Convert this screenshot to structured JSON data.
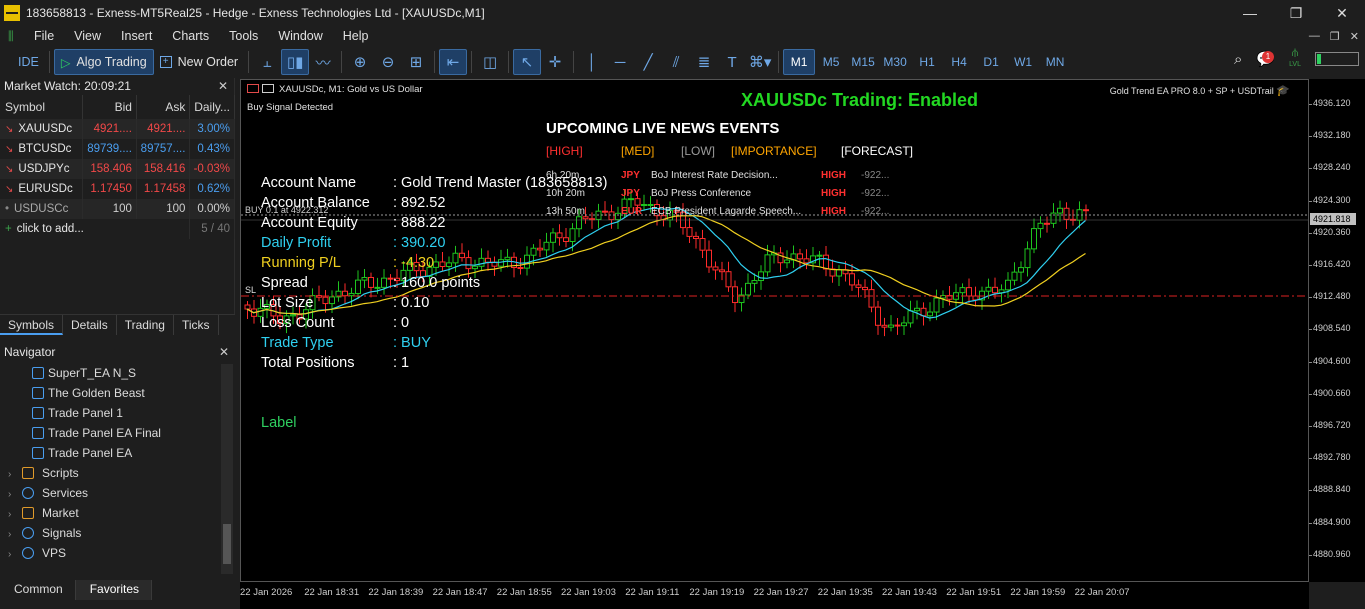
{
  "window": {
    "title": "183658813 - Exness-MT5Real25 - Hedge - Exness Technologies Ltd - [XAUUSDc,M1]",
    "buttons": [
      "—",
      "❐",
      "✕"
    ]
  },
  "menu": [
    "File",
    "View",
    "Insert",
    "Charts",
    "Tools",
    "Window",
    "Help"
  ],
  "toolbar": {
    "ide": "IDE",
    "algo_trading": "Algo Trading",
    "new_order": "New Order",
    "timeframes": [
      "M1",
      "M5",
      "M15",
      "M30",
      "H1",
      "H4",
      "D1",
      "W1",
      "MN"
    ],
    "active_timeframe": "M1",
    "notification_count": "1",
    "lvl": "LVL"
  },
  "market_watch": {
    "header": "Market Watch: 20:09:21",
    "columns": [
      "Symbol",
      "Bid",
      "Ask",
      "Daily..."
    ],
    "rows": [
      {
        "symbol": "XAUUSDc",
        "bid": "4921....",
        "ask": "4921....",
        "daily": "3.00%",
        "trend": "down"
      },
      {
        "symbol": "BTCUSDc",
        "bid": "89739....",
        "ask": "89757....",
        "daily": "0.43%",
        "trend": "down"
      },
      {
        "symbol": "USDJPYc",
        "bid": "158.406",
        "ask": "158.416",
        "daily": "-0.03%",
        "trend": "down"
      },
      {
        "symbol": "EURUSDc",
        "bid": "1.17450",
        "ask": "1.17458",
        "daily": "0.62%",
        "trend": "down"
      },
      {
        "symbol": "USDUSCc",
        "bid": "100",
        "ask": "100",
        "daily": "0.00%",
        "trend": "flat"
      }
    ],
    "click_to_add": "click to add...",
    "count": "5 / 40",
    "tabs": [
      "Symbols",
      "Details",
      "Trading",
      "Ticks"
    ]
  },
  "navigator": {
    "header": "Navigator",
    "items": [
      {
        "label": "SuperT_EA N_S",
        "type": "ea"
      },
      {
        "label": "The Golden Beast",
        "type": "ea"
      },
      {
        "label": "Trade Panel 1",
        "type": "ea"
      },
      {
        "label": "Trade Panel EA Final",
        "type": "ea"
      },
      {
        "label": "Trade Panel EA",
        "type": "ea"
      },
      {
        "label": "Scripts",
        "type": "folder"
      },
      {
        "label": "Services",
        "type": "folder"
      },
      {
        "label": "Market",
        "type": "folder"
      },
      {
        "label": "Signals",
        "type": "folder"
      },
      {
        "label": "VPS",
        "type": "folder"
      }
    ],
    "tabs": [
      "Common",
      "Favorites"
    ]
  },
  "chart": {
    "title": "XAUUSDc, M1:  Gold vs US Dollar",
    "buy_signal": "Buy Signal Detected",
    "ea_name": "Gold Trend EA PRO 8.0 + SP + USDTrail",
    "trading_status": "XAUUSDc Trading: Enabled",
    "news_title": "UPCOMING LIVE NEWS EVENTS",
    "legend": [
      {
        "text": "[HIGH]",
        "color": "#ff3030"
      },
      {
        "text": "[MED]",
        "color": "#ffa500"
      },
      {
        "text": "[LOW]",
        "color": "#9a9a9a"
      },
      {
        "text": "[IMPORTANCE]",
        "color": "#ffa500"
      },
      {
        "text": "[FORECAST]",
        "color": "#ffffff"
      }
    ],
    "news": [
      {
        "time": "6h 20m",
        "currency": "JPY",
        "event": "BoJ Interest Rate Decision...",
        "impact": "HIGH",
        "forecast": "-922..."
      },
      {
        "time": "10h 20m",
        "currency": "JPY",
        "event": "BoJ Press Conference",
        "impact": "HIGH",
        "forecast": "-922..."
      },
      {
        "time": "13h 50m",
        "currency": "EUR",
        "event": "ECB President Lagarde Speech...",
        "impact": "HIGH",
        "forecast": "-922..."
      }
    ],
    "account": [
      {
        "label": "Account Name",
        "value": ": Gold Trend Master (183658813)",
        "color": "#ffffff"
      },
      {
        "label": "Account Balance",
        "value": ": 892.52",
        "color": "#ffffff"
      },
      {
        "label": "Account Equity",
        "value": ": 888.22",
        "color": "#ffffff"
      },
      {
        "label": "Daily Profit",
        "value": ": 390.20",
        "color": "#2fd0f0"
      },
      {
        "label": "Running P/L",
        "value": ": -4.30",
        "color": "#f0d020"
      },
      {
        "label": "Spread",
        "value": ": 160.0 points",
        "color": "#ffffff"
      },
      {
        "label": "Lot Size",
        "value": ": 0.10",
        "color": "#ffffff"
      },
      {
        "label": "Loss Count",
        "value": ": 0",
        "color": "#ffffff"
      },
      {
        "label": "Trade Type",
        "value": ": BUY",
        "color": "#2fd0f0"
      },
      {
        "label": "Total Positions",
        "value": ": 1",
        "color": "#ffffff"
      }
    ],
    "label_text": "Label",
    "buy_line_label": "BUY 0.1 at 4922.312",
    "sl_label": "SL",
    "current_price": "4921.818",
    "price_labels": [
      "4936.120",
      "4932.180",
      "4928.240",
      "4924.300",
      "4920.360",
      "4916.420",
      "4912.480",
      "4908.540",
      "4904.600",
      "4900.660",
      "4896.720",
      "4892.780",
      "4888.840",
      "4884.900",
      "4880.960"
    ],
    "time_labels": [
      "22 Jan 2026",
      "22 Jan 18:31",
      "22 Jan 18:39",
      "22 Jan 18:47",
      "22 Jan 18:55",
      "22 Jan 19:03",
      "22 Jan 19:11",
      "22 Jan 19:19",
      "22 Jan 19:27",
      "22 Jan 19:35",
      "22 Jan 19:43",
      "22 Jan 19:51",
      "22 Jan 19:59",
      "22 Jan 20:07"
    ]
  }
}
